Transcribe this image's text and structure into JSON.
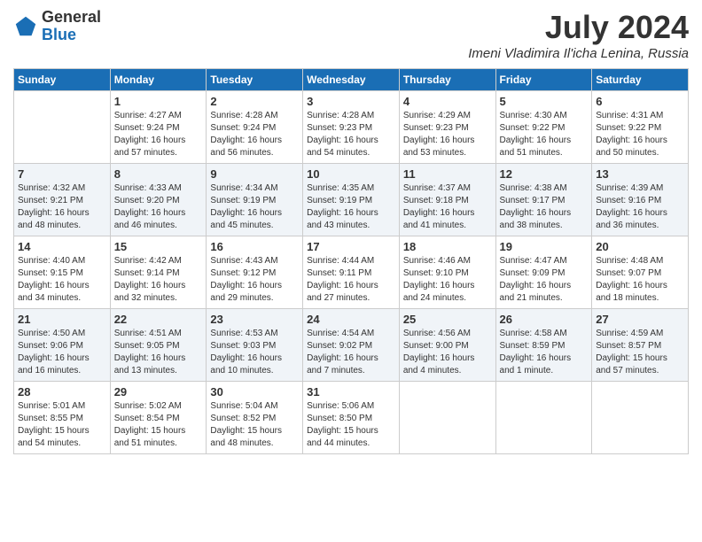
{
  "header": {
    "logo_general": "General",
    "logo_blue": "Blue",
    "month_title": "July 2024",
    "subtitle": "Imeni Vladimira Il'icha Lenina, Russia"
  },
  "days_of_week": [
    "Sunday",
    "Monday",
    "Tuesday",
    "Wednesday",
    "Thursday",
    "Friday",
    "Saturday"
  ],
  "weeks": [
    [
      {
        "day": "",
        "text": ""
      },
      {
        "day": "1",
        "text": "Sunrise: 4:27 AM\nSunset: 9:24 PM\nDaylight: 16 hours\nand 57 minutes."
      },
      {
        "day": "2",
        "text": "Sunrise: 4:28 AM\nSunset: 9:24 PM\nDaylight: 16 hours\nand 56 minutes."
      },
      {
        "day": "3",
        "text": "Sunrise: 4:28 AM\nSunset: 9:23 PM\nDaylight: 16 hours\nand 54 minutes."
      },
      {
        "day": "4",
        "text": "Sunrise: 4:29 AM\nSunset: 9:23 PM\nDaylight: 16 hours\nand 53 minutes."
      },
      {
        "day": "5",
        "text": "Sunrise: 4:30 AM\nSunset: 9:22 PM\nDaylight: 16 hours\nand 51 minutes."
      },
      {
        "day": "6",
        "text": "Sunrise: 4:31 AM\nSunset: 9:22 PM\nDaylight: 16 hours\nand 50 minutes."
      }
    ],
    [
      {
        "day": "7",
        "text": "Sunrise: 4:32 AM\nSunset: 9:21 PM\nDaylight: 16 hours\nand 48 minutes."
      },
      {
        "day": "8",
        "text": "Sunrise: 4:33 AM\nSunset: 9:20 PM\nDaylight: 16 hours\nand 46 minutes."
      },
      {
        "day": "9",
        "text": "Sunrise: 4:34 AM\nSunset: 9:19 PM\nDaylight: 16 hours\nand 45 minutes."
      },
      {
        "day": "10",
        "text": "Sunrise: 4:35 AM\nSunset: 9:19 PM\nDaylight: 16 hours\nand 43 minutes."
      },
      {
        "day": "11",
        "text": "Sunrise: 4:37 AM\nSunset: 9:18 PM\nDaylight: 16 hours\nand 41 minutes."
      },
      {
        "day": "12",
        "text": "Sunrise: 4:38 AM\nSunset: 9:17 PM\nDaylight: 16 hours\nand 38 minutes."
      },
      {
        "day": "13",
        "text": "Sunrise: 4:39 AM\nSunset: 9:16 PM\nDaylight: 16 hours\nand 36 minutes."
      }
    ],
    [
      {
        "day": "14",
        "text": "Sunrise: 4:40 AM\nSunset: 9:15 PM\nDaylight: 16 hours\nand 34 minutes."
      },
      {
        "day": "15",
        "text": "Sunrise: 4:42 AM\nSunset: 9:14 PM\nDaylight: 16 hours\nand 32 minutes."
      },
      {
        "day": "16",
        "text": "Sunrise: 4:43 AM\nSunset: 9:12 PM\nDaylight: 16 hours\nand 29 minutes."
      },
      {
        "day": "17",
        "text": "Sunrise: 4:44 AM\nSunset: 9:11 PM\nDaylight: 16 hours\nand 27 minutes."
      },
      {
        "day": "18",
        "text": "Sunrise: 4:46 AM\nSunset: 9:10 PM\nDaylight: 16 hours\nand 24 minutes."
      },
      {
        "day": "19",
        "text": "Sunrise: 4:47 AM\nSunset: 9:09 PM\nDaylight: 16 hours\nand 21 minutes."
      },
      {
        "day": "20",
        "text": "Sunrise: 4:48 AM\nSunset: 9:07 PM\nDaylight: 16 hours\nand 18 minutes."
      }
    ],
    [
      {
        "day": "21",
        "text": "Sunrise: 4:50 AM\nSunset: 9:06 PM\nDaylight: 16 hours\nand 16 minutes."
      },
      {
        "day": "22",
        "text": "Sunrise: 4:51 AM\nSunset: 9:05 PM\nDaylight: 16 hours\nand 13 minutes."
      },
      {
        "day": "23",
        "text": "Sunrise: 4:53 AM\nSunset: 9:03 PM\nDaylight: 16 hours\nand 10 minutes."
      },
      {
        "day": "24",
        "text": "Sunrise: 4:54 AM\nSunset: 9:02 PM\nDaylight: 16 hours\nand 7 minutes."
      },
      {
        "day": "25",
        "text": "Sunrise: 4:56 AM\nSunset: 9:00 PM\nDaylight: 16 hours\nand 4 minutes."
      },
      {
        "day": "26",
        "text": "Sunrise: 4:58 AM\nSunset: 8:59 PM\nDaylight: 16 hours\nand 1 minute."
      },
      {
        "day": "27",
        "text": "Sunrise: 4:59 AM\nSunset: 8:57 PM\nDaylight: 15 hours\nand 57 minutes."
      }
    ],
    [
      {
        "day": "28",
        "text": "Sunrise: 5:01 AM\nSunset: 8:55 PM\nDaylight: 15 hours\nand 54 minutes."
      },
      {
        "day": "29",
        "text": "Sunrise: 5:02 AM\nSunset: 8:54 PM\nDaylight: 15 hours\nand 51 minutes."
      },
      {
        "day": "30",
        "text": "Sunrise: 5:04 AM\nSunset: 8:52 PM\nDaylight: 15 hours\nand 48 minutes."
      },
      {
        "day": "31",
        "text": "Sunrise: 5:06 AM\nSunset: 8:50 PM\nDaylight: 15 hours\nand 44 minutes."
      },
      {
        "day": "",
        "text": ""
      },
      {
        "day": "",
        "text": ""
      },
      {
        "day": "",
        "text": ""
      }
    ]
  ]
}
